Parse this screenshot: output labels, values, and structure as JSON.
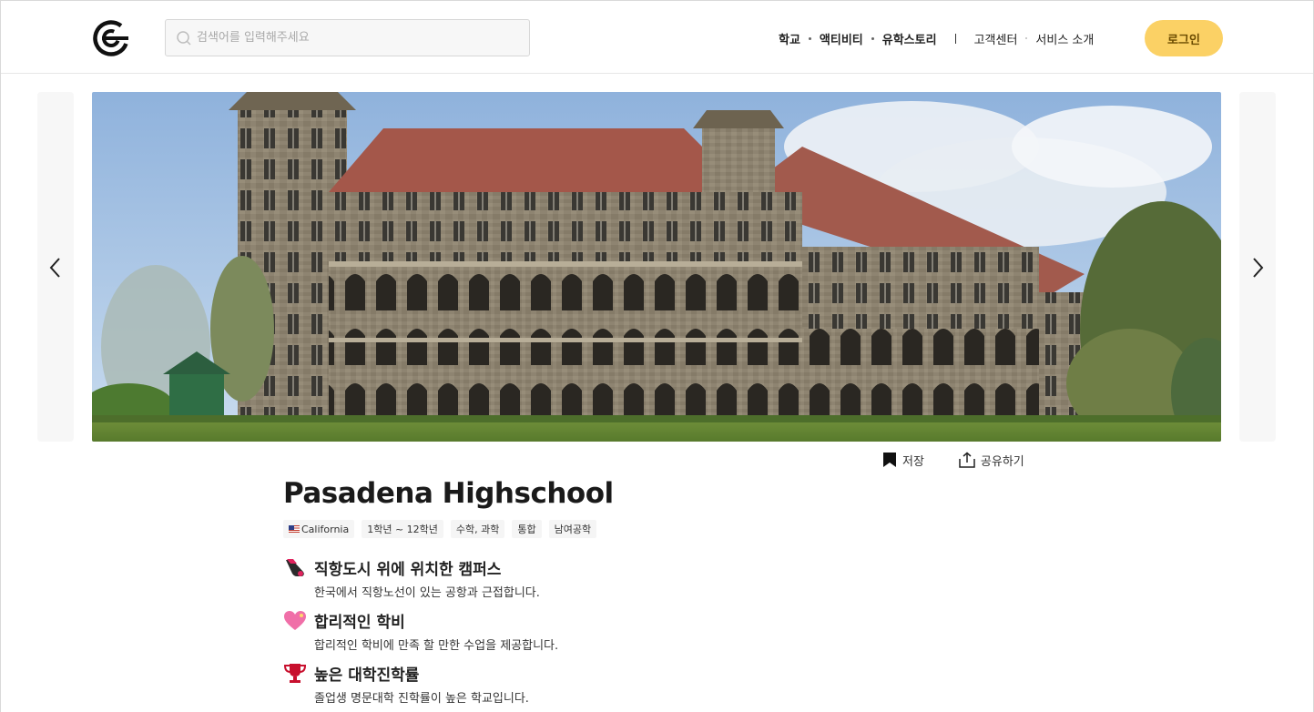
{
  "header": {
    "logo_alt": "logo",
    "search_placeholder": "검색어를 입력해주세요",
    "nav_primary": [
      "학교",
      "액티비티",
      "유학스토리"
    ],
    "nav_secondary": [
      "고객센터",
      "서비스 소개"
    ],
    "login_label": "로그인"
  },
  "carousel": {
    "prev_icon": "chevron-left-icon",
    "next_icon": "chevron-right-icon"
  },
  "actions": {
    "save_label": "저장",
    "share_label": "공유하기"
  },
  "school": {
    "name": "Pasadena Highschool",
    "tags": [
      "California",
      "1학년 ~ 12학년",
      "수학, 과학",
      "통합",
      "남여공학"
    ],
    "features": [
      {
        "icon": "airplane-icon",
        "title": "직항도시 위에 위치한 캠퍼스",
        "desc": "한국에서 직항노선이 있는 공항과 근접합니다."
      },
      {
        "icon": "heart-icon",
        "title": "합리적인 학비",
        "desc": "합리적인 학비에 만족 할 만한 수업을 제공합니다."
      },
      {
        "icon": "trophy-icon",
        "title": "높은 대학진학률",
        "desc": "졸업생 명문대학 진학률이 높은 학교입니다."
      }
    ]
  },
  "colors": {
    "accent": "#fbd165",
    "accent_text": "#6b4b00"
  }
}
